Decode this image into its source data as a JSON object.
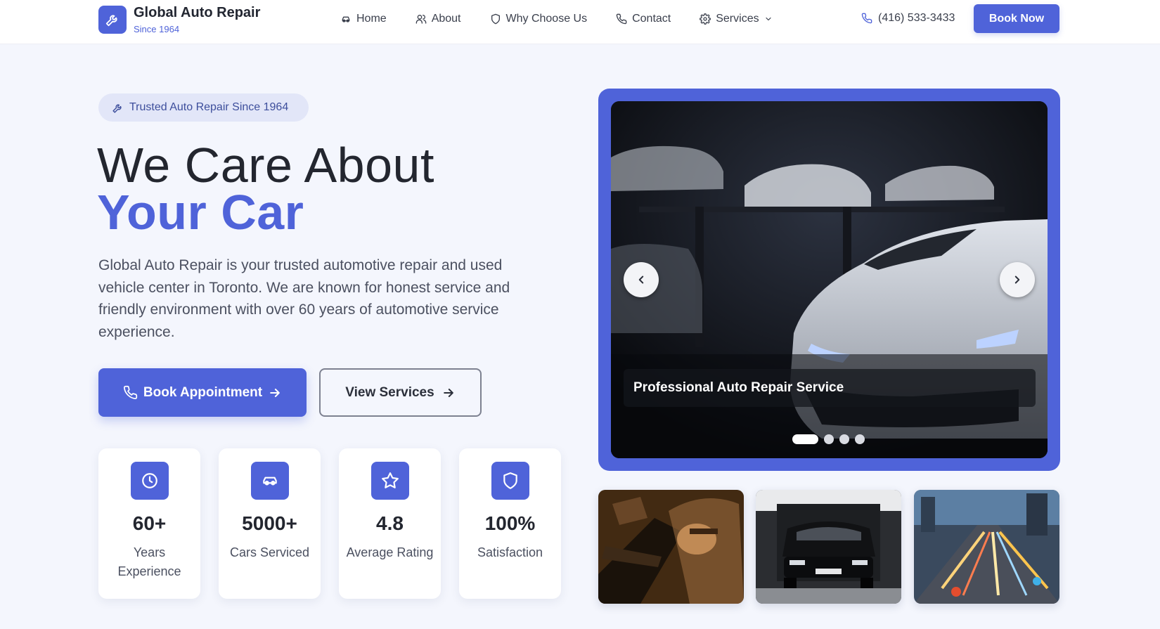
{
  "brand": {
    "name": "Global Auto Repair",
    "tagline": "Since 1964",
    "logo_icon": "wrench-icon"
  },
  "nav": {
    "items": [
      {
        "label": "Home",
        "icon": "car-icon"
      },
      {
        "label": "About",
        "icon": "users-icon"
      },
      {
        "label": "Why Choose Us",
        "icon": "shield-icon"
      },
      {
        "label": "Contact",
        "icon": "phone-icon"
      },
      {
        "label": "Services",
        "icon": "gear-icon",
        "dropdown": true
      }
    ],
    "phone": "(416) 533-3433",
    "book_label": "Book Now"
  },
  "hero": {
    "badge": "Trusted Auto Repair Since 1964",
    "title_line1": "We Care About",
    "title_line2": "Your Car",
    "description": "Global Auto Repair is your trusted automotive repair and used vehicle center in Toronto. We are known for honest service and friendly environment with over 60 years of automotive service experience.",
    "primary_button": "Book Appointment",
    "secondary_button": "View Services"
  },
  "stats": [
    {
      "value": "60+",
      "label": "Years Experience",
      "icon": "clock-icon"
    },
    {
      "value": "5000+",
      "label": "Cars Serviced",
      "icon": "car-icon"
    },
    {
      "value": "4.8",
      "label": "Average Rating",
      "icon": "star-icon"
    },
    {
      "value": "100%",
      "label": "Satisfaction",
      "icon": "shield-icon"
    }
  ],
  "carousel": {
    "caption": "Professional Auto Repair Service",
    "slide_count": 4,
    "active_slide": 1
  },
  "colors": {
    "accent": "#4f63d9",
    "background": "#f4f6fd",
    "text": "#23262f"
  }
}
